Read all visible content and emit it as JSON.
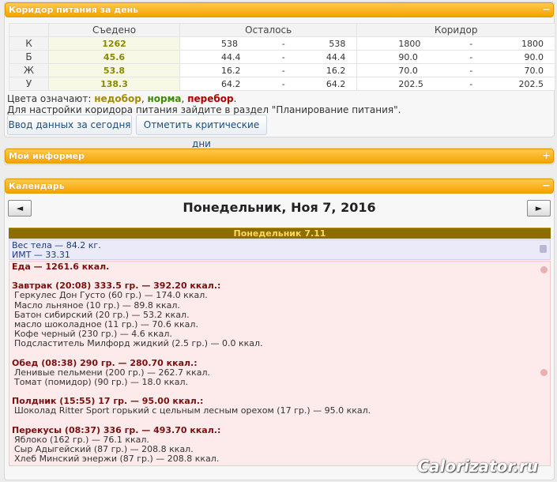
{
  "panel1": {
    "title": "Коридор питания за день",
    "toggle": "−",
    "headers": [
      "Съедено",
      "Осталось",
      "Коридор"
    ],
    "rows": [
      {
        "label": "К",
        "eaten": "1262",
        "left_from": "538",
        "left_to": "538",
        "cor_from": "1800",
        "cor_to": "1800"
      },
      {
        "label": "Б",
        "eaten": "45.6",
        "left_from": "44.4",
        "left_to": "44.4",
        "cor_from": "90.0",
        "cor_to": "90.0"
      },
      {
        "label": "Ж",
        "eaten": "53.8",
        "left_from": "16.2",
        "left_to": "16.2",
        "cor_from": "70.0",
        "cor_to": "70.0"
      },
      {
        "label": "У",
        "eaten": "138.3",
        "left_from": "64.2",
        "left_to": "64.2",
        "cor_from": "202.5",
        "cor_to": "202.5"
      }
    ],
    "dash": "-",
    "legend_prefix": "Цвета означают:",
    "legend_under": "недобор",
    "legend_norm": "норма",
    "legend_over": "перебор",
    "legend_comma": ",",
    "legend_end": ".",
    "note": "Для настройки коридора питания зайдите в раздел \"Планирование питания\".",
    "btn_input": "Ввод данных за сегодня",
    "btn_critical": "Отметить критические дни"
  },
  "panel2": {
    "title": "Мой информер",
    "toggle": "+"
  },
  "panel3": {
    "title": "Календарь",
    "toggle": "−",
    "prev": "◄",
    "next": "►",
    "date_title": "Понедельник, Ноя 7, 2016",
    "day_header": "Понедельник 7.11",
    "weight": "Вес тела — 84.2 кг.",
    "bmi": "ИМТ — 33.31",
    "food_total": "Еда — 1261.6 ккал.",
    "meals": [
      {
        "title": "Завтрак (20:08) 333.5 гр. — 392.20 ккал.:",
        "items": [
          "Геркулес Дон Густо (60 гр.) — 174.0 ккал.",
          "Масло льняное (10 гр.) — 89.8 ккал.",
          "Батон сибирский (20 гр.) — 53.2 ккал.",
          "масло шоколадное (11 гр.) — 70.6 ккал.",
          "Кофе черный (230 гр.) — 4.6 ккал.",
          "Подсластитель Милфорд жидкий (2.5 гр.) — 0.0 ккал."
        ]
      },
      {
        "title": "Обед (08:38) 290 гр. — 280.70 ккал.:",
        "items": [
          "Ленивые пельмени (200 гр.) — 262.7 ккал.",
          "Томат (помидор) (90 гр.) — 18.0 ккал."
        ]
      },
      {
        "title": "Полдник (15:55) 17 гр. — 95.00 ккал.:",
        "items": [
          "Шоколад Ritter Sport горький с цельным лесным орехом (17 гр.) — 95.0 ккал."
        ]
      },
      {
        "title": "Перекусы (08:37) 336 гр. — 493.70 ккал.:",
        "items": [
          "Яблоко (162 гр.) — 76.1 ккал.",
          "Сыр Адыгейский (87 гр.) — 208.8 ккал.",
          "Хлеб Минский энержи (87 гр.) — 208.8 ккал."
        ]
      }
    ]
  },
  "watermark": "Calorizator.ru"
}
